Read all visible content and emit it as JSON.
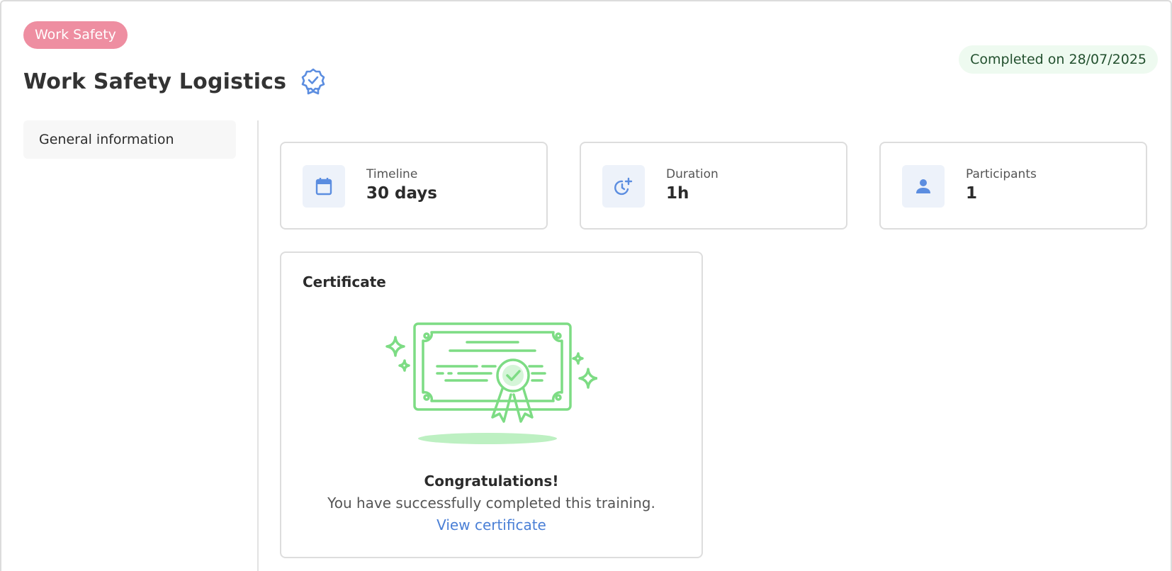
{
  "header": {
    "category": "Work Safety",
    "title": "Work Safety Logistics",
    "status": "Completed on 28/07/2025"
  },
  "sidebar": {
    "items": [
      {
        "label": "General information",
        "active": true
      }
    ]
  },
  "stats": [
    {
      "label": "Timeline",
      "value": "30 days",
      "icon": "calendar-icon"
    },
    {
      "label": "Duration",
      "value": "1h",
      "icon": "clock-plus-icon"
    },
    {
      "label": "Participants",
      "value": "1",
      "icon": "person-icon"
    }
  ],
  "certificate": {
    "heading": "Certificate",
    "congrats": "Congratulations!",
    "message": "You have successfully completed this training.",
    "link": "View certificate"
  },
  "colors": {
    "category_pill": "#ee8ea1",
    "status_bg": "#eefaf0",
    "status_text": "#22502e",
    "accent_blue": "#4a7fd6",
    "cert_green": "#7ddc84"
  }
}
